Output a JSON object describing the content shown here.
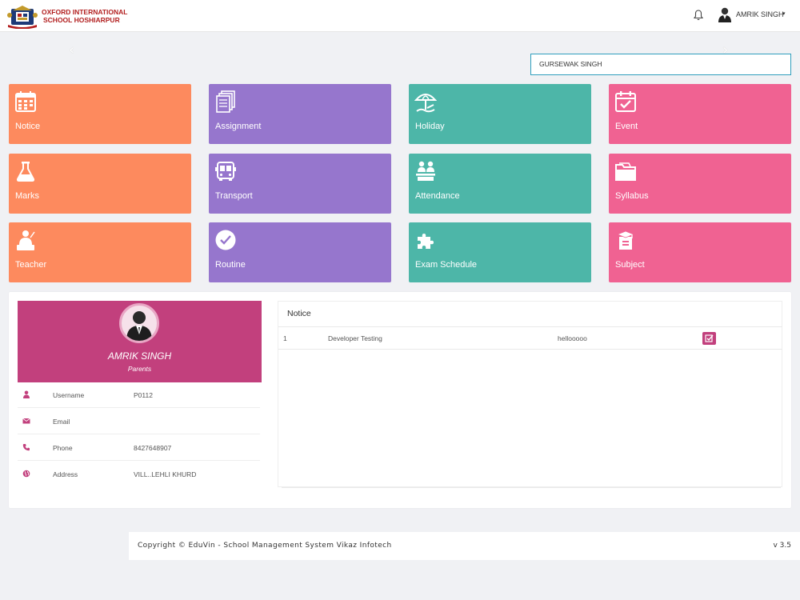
{
  "header": {
    "school_name_line1": "OXFORD INTERNATIONAL",
    "school_name_line2": "SCHOOL HOSHIARPUR",
    "user_name": "AMRIK SINGH",
    "caret": "▾"
  },
  "student_selector": {
    "value": "GURSEWAK SINGH"
  },
  "slider": {
    "prev": "‹",
    "next": "›"
  },
  "tiles": [
    {
      "label": "Notice",
      "icon": "calendar-grid-icon",
      "color": "#fd8a5e"
    },
    {
      "label": "Assignment",
      "icon": "documents-icon",
      "color": "#9676cd"
    },
    {
      "label": "Holiday",
      "icon": "beach-umbrella-icon",
      "color": "#4db6a8"
    },
    {
      "label": "Event",
      "icon": "calendar-check-icon",
      "color": "#f06292"
    },
    {
      "label": "Marks",
      "icon": "flask-icon",
      "color": "#fd8a5e"
    },
    {
      "label": "Transport",
      "icon": "bus-icon",
      "color": "#9676cd"
    },
    {
      "label": "Attendance",
      "icon": "attendance-icon",
      "color": "#4db6a8"
    },
    {
      "label": "Syllabus",
      "icon": "folder-icon",
      "color": "#f06292"
    },
    {
      "label": "Teacher",
      "icon": "teacher-icon",
      "color": "#fd8a5e"
    },
    {
      "label": "Routine",
      "icon": "clock-check-icon",
      "color": "#9676cd"
    },
    {
      "label": "Exam Schedule",
      "icon": "puzzle-icon",
      "color": "#4db6a8"
    },
    {
      "label": "Subject",
      "icon": "book-cap-icon",
      "color": "#f06292"
    }
  ],
  "profile": {
    "name": "AMRIK SINGH",
    "role": "Parents",
    "rows": [
      {
        "icon": "user-icon",
        "label": "Username",
        "value": "P0112"
      },
      {
        "icon": "envelope-icon",
        "label": "Email",
        "value": ""
      },
      {
        "icon": "phone-icon",
        "label": "Phone",
        "value": "8427648907"
      },
      {
        "icon": "globe-icon",
        "label": "Address",
        "value": "VILL..LEHLI KHURD"
      }
    ]
  },
  "notice": {
    "title": "Notice",
    "rows": [
      {
        "no": "1",
        "title": "Developer Testing",
        "desc": "hellooooo"
      }
    ]
  },
  "footer": {
    "text": "Copyright © EduVin - School Management System Vikaz Infotech",
    "version": "v 3.5"
  },
  "colors": {
    "accent": "#c2407d",
    "orange": "#fd8a5e",
    "purple": "#9676cd",
    "teal": "#4db6a8",
    "pink": "#f06292",
    "input_border": "#2f9ebd"
  }
}
